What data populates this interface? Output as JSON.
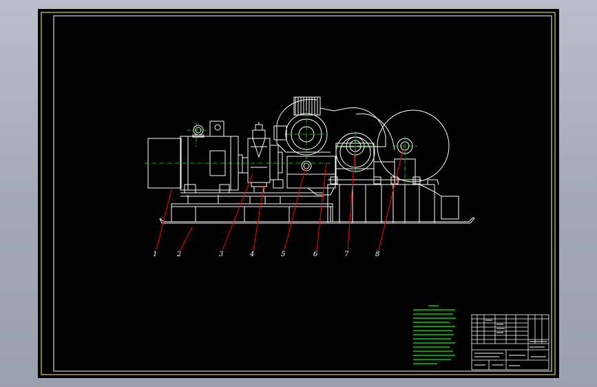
{
  "drawing": {
    "part_labels": [
      "1",
      "2",
      "3",
      "4",
      "5",
      "6",
      "7",
      "8"
    ],
    "colors": {
      "sheet_background": "#000000",
      "border": "#ffff66",
      "outline": "#ffffff",
      "centerline": "#00ff00",
      "leader": "#ff0000",
      "notes_text": "#00ff00"
    }
  }
}
